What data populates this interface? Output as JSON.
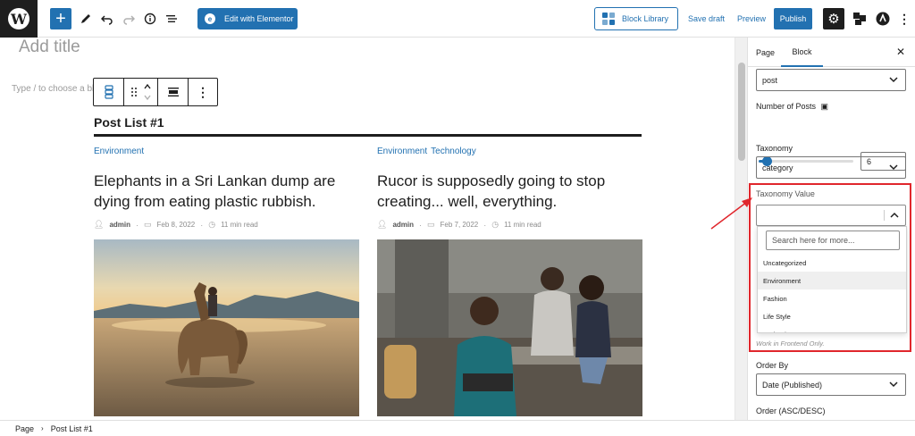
{
  "toolbar": {
    "logo_glyph": "W",
    "edit_elementor_label": "Edit with Elementor",
    "block_library_label": "Block Library",
    "save_draft_label": "Save draft",
    "preview_label": "Preview",
    "publish_label": "Publish",
    "accent": "#2271b1"
  },
  "canvas": {
    "title_placeholder": "Add title",
    "type_hint": "Type / to choose a block",
    "block_title": "Post List #1",
    "posts": [
      {
        "categories": [
          "Environment"
        ],
        "title": "Elephants in a Sri Lankan dump are dying from eating plastic rubbish.",
        "author": "admin",
        "date": "Feb 8, 2022",
        "read_time": "11 min read"
      },
      {
        "categories": [
          "Environment",
          "Technology"
        ],
        "title": "Rucor is supposedly going to stop creating... well, everything.",
        "author": "admin",
        "date": "Feb 7, 2022",
        "read_time": "11 min read"
      }
    ]
  },
  "sidebar": {
    "tabs": [
      "Page",
      "Block"
    ],
    "active_tab": "Block",
    "post_type_value": "post",
    "number_of_posts_label": "Number of Posts",
    "number_of_posts_value": "6",
    "number_of_posts_fraction": 0.06,
    "taxonomy_label": "Taxonomy",
    "taxonomy_value": "category",
    "taxonomy_value_label": "Taxonomy Value",
    "search_placeholder": "Search here for more...",
    "options": [
      "Uncategorized",
      "Environment",
      "Fashion",
      "Life Style",
      "Technology"
    ],
    "highlighted_option": "Environment",
    "helper_text": "Work in Frontend Only.",
    "order_by_label": "Order By",
    "order_by_value": "Date (Published)",
    "order_label": "Order (ASC/DESC)"
  },
  "footer": {
    "breadcrumb": [
      "Page",
      "Post List #1"
    ]
  },
  "annotation": {
    "highlight_color": "#e0262c"
  }
}
